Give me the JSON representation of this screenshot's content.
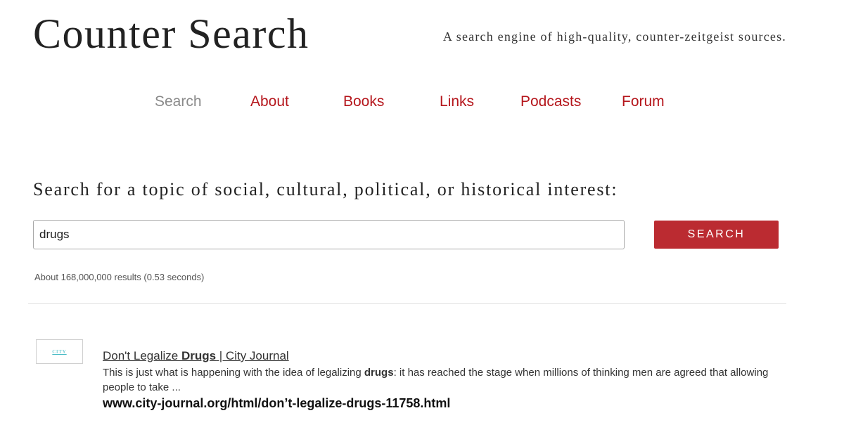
{
  "header": {
    "site_title": "Counter Search",
    "tagline": "A search engine of high-quality, counter-zeitgeist sources."
  },
  "nav": {
    "items": [
      {
        "label": "Search",
        "active": true
      },
      {
        "label": "About",
        "active": false
      },
      {
        "label": "Books",
        "active": false
      },
      {
        "label": "Links",
        "active": false
      },
      {
        "label": "Podcasts",
        "active": false
      },
      {
        "label": "Forum",
        "active": false
      }
    ]
  },
  "search": {
    "prompt": "Search for a topic of social, cultural, political, or historical interest:",
    "query": "drugs",
    "button_label": "SEARCH",
    "stats": "About 168,000,000 results (0.53 seconds)"
  },
  "results": [
    {
      "thumbnail_text": "CITY",
      "title_before": "Don't Legalize ",
      "title_bold": "Drugs",
      "title_after": " | City Journal",
      "snippet_before": "This is just what is happening with the idea of legalizing ",
      "snippet_bold": "drugs",
      "snippet_after": ": it has reached the stage when millions of thinking men are agreed that allowing people to take ...",
      "url": "www.city-journal.org/html/don’t-legalize-drugs-11758.html"
    }
  ],
  "colors": {
    "accent": "#b5161c",
    "button": "#bb2b31",
    "nav_active": "#8a8a8a"
  }
}
